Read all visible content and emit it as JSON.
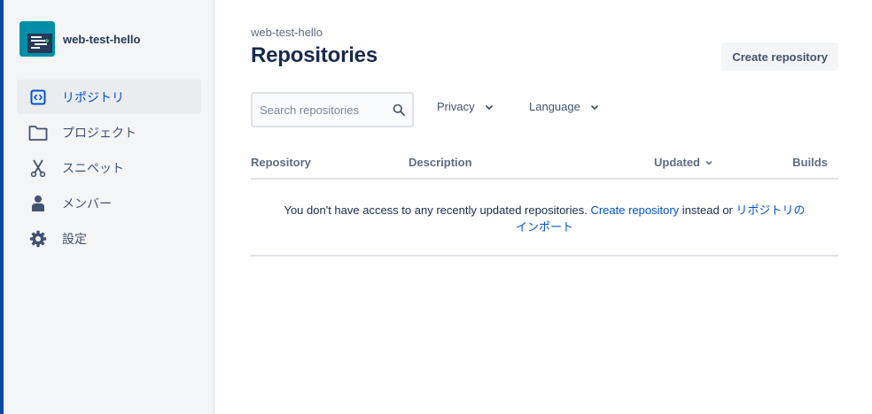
{
  "workspace": {
    "name": "web-test-hello"
  },
  "sidebar": {
    "items": [
      {
        "label": "リポジトリ",
        "icon": "repository-icon",
        "active": true
      },
      {
        "label": "プロジェクト",
        "icon": "folder-icon",
        "active": false
      },
      {
        "label": "スニペット",
        "icon": "scissors-icon",
        "active": false
      },
      {
        "label": "メンバー",
        "icon": "person-icon",
        "active": false
      },
      {
        "label": "設定",
        "icon": "gear-icon",
        "active": false
      }
    ]
  },
  "header": {
    "breadcrumb": "web-test-hello",
    "title": "Repositories",
    "create_button": "Create repository"
  },
  "filters": {
    "search_placeholder": "Search repositories",
    "privacy_label": "Privacy",
    "language_label": "Language"
  },
  "table": {
    "columns": [
      "Repository",
      "Description",
      "Updated",
      "Builds"
    ],
    "empty": {
      "text_before": "You don't have access to any recently updated repositories. ",
      "create_link": "Create repository",
      "text_middle": " instead or ",
      "import_link": "リポジトリのインポート"
    }
  },
  "colors": {
    "accent": "#0052cc",
    "sidebar_bg": "#f4f5f7",
    "edge": "#0747a6"
  }
}
